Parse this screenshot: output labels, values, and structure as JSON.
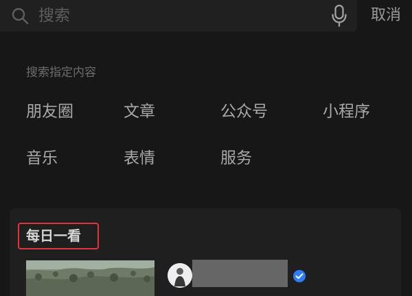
{
  "search": {
    "placeholder": "搜索",
    "cancel_label": "取消"
  },
  "search_options": {
    "hint": "搜索指定内容",
    "items": [
      {
        "label": "朋友圈"
      },
      {
        "label": "文章"
      },
      {
        "label": "公众号"
      },
      {
        "label": "小程序"
      },
      {
        "label": "音乐"
      },
      {
        "label": "表情"
      },
      {
        "label": "服务"
      }
    ]
  },
  "daily": {
    "title": "每日一看"
  },
  "icons": {
    "search": "search-icon",
    "microphone": "microphone-icon",
    "verified": "verified-badge-icon"
  },
  "colors": {
    "background": "#171717",
    "highlight_border": "#e0353c",
    "verified_blue": "#2f7cf6"
  }
}
